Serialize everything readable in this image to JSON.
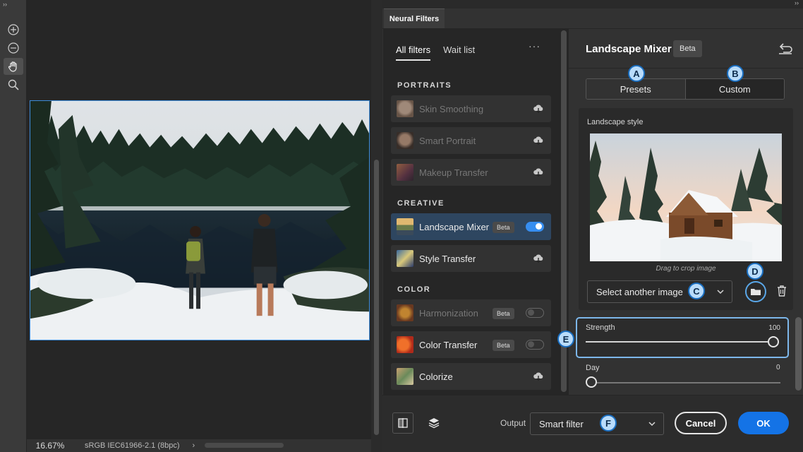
{
  "toolbar": {
    "tools": [
      {
        "name": "zoom-in-icon",
        "active": false
      },
      {
        "name": "zoom-out-icon",
        "active": false
      },
      {
        "name": "hand-icon",
        "active": true
      },
      {
        "name": "magnifier-icon",
        "active": false
      }
    ]
  },
  "status": {
    "zoom": "16.67%",
    "profile": "sRGB IEC61966-2.1 (8bpc)",
    "arrow": "›"
  },
  "panel": {
    "tab_label": "Neural Filters",
    "list_tabs": [
      "All filters",
      "Wait list"
    ],
    "more": "···",
    "sections": [
      "PORTRAITS",
      "CREATIVE",
      "COLOR"
    ],
    "filters": [
      {
        "name": "Skin Smoothing",
        "enabled": false,
        "control": "download"
      },
      {
        "name": "Smart Portrait",
        "enabled": false,
        "control": "download"
      },
      {
        "name": "Makeup Transfer",
        "enabled": false,
        "control": "download"
      },
      {
        "name": "Landscape Mixer",
        "enabled": true,
        "control": "toggle",
        "beta": "Beta",
        "toggle_on": true
      },
      {
        "name": "Style Transfer",
        "enabled": true,
        "control": "download"
      },
      {
        "name": "Harmonization",
        "enabled": false,
        "control": "toggle",
        "beta": "Beta",
        "toggle_on": false
      },
      {
        "name": "Color Transfer",
        "enabled": true,
        "control": "toggle",
        "beta": "Beta",
        "toggle_on": false
      },
      {
        "name": "Colorize",
        "enabled": true,
        "control": "download"
      }
    ]
  },
  "detail": {
    "title": "Landscape Mixer",
    "beta": "Beta",
    "tabs": {
      "presets": "Presets",
      "custom": "Custom"
    },
    "style_label": "Landscape style",
    "drag_hint": "Drag to crop image",
    "select_image": "Select another image",
    "strength": {
      "label": "Strength",
      "value": "100"
    },
    "day": {
      "label": "Day",
      "value": "0"
    }
  },
  "bottom": {
    "output_label": "Output",
    "output_value": "Smart filter",
    "cancel": "Cancel",
    "ok": "OK"
  },
  "callouts": [
    "A",
    "B",
    "C",
    "D",
    "E",
    "F"
  ],
  "colors": {
    "accent": "#1473e6",
    "active_item": "#2e4660",
    "callout_fill": "#b9dcfb",
    "callout_border": "#1a6ec0"
  }
}
